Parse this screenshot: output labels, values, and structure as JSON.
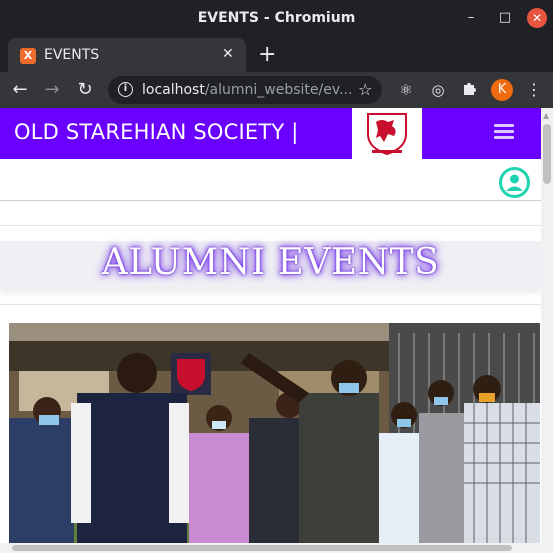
{
  "window": {
    "title": "EVENTS - Chromium"
  },
  "tab": {
    "label": "EVENTS",
    "favicon": "X"
  },
  "toolbar": {
    "url_host": "localhost",
    "url_path": "/alumni_website/ev...",
    "profile_initial": "K"
  },
  "navbar": {
    "brand": "OLD STAREHIAN SOCIETY |",
    "color": "#6a00ff"
  },
  "banner": {
    "heading": "ALUMNI EVENTS"
  },
  "colors": {
    "accent": "#6a00ff",
    "user_icon": "#1fd3b0",
    "close_button": "#e8553f"
  }
}
